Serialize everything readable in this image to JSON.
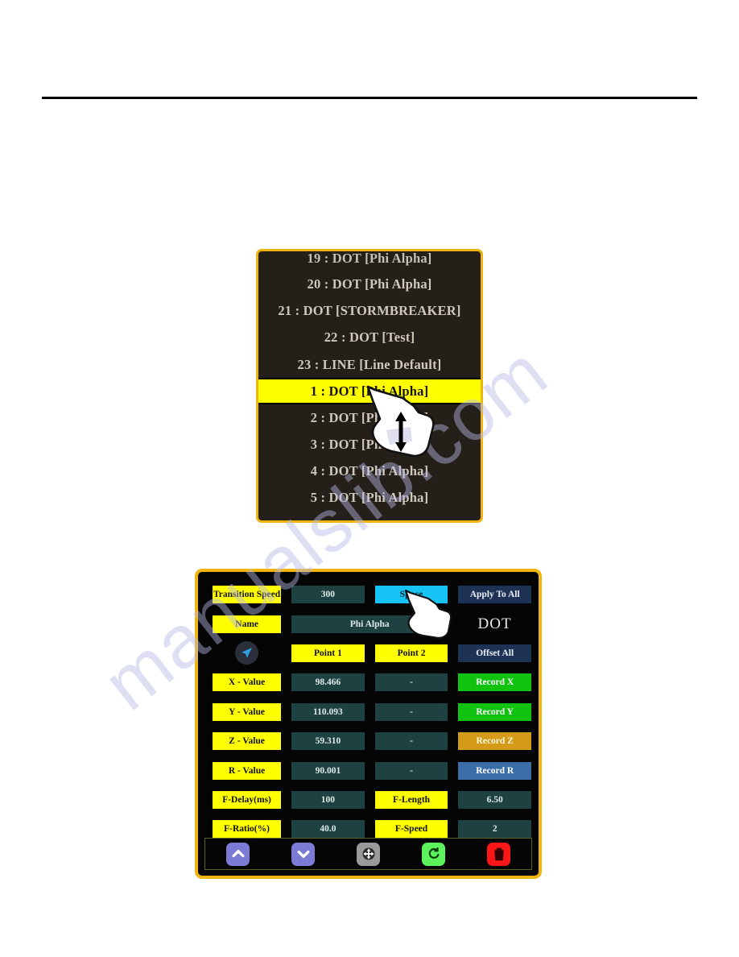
{
  "page": {
    "watermark": "manualslib.com",
    "background_color": "#ffffff",
    "rule_color": "#000000"
  },
  "list_panel": {
    "name": "point-list",
    "border_color": "#f0b410",
    "background_color": "#241f18",
    "highlight_color": "#ffff00",
    "rows": [
      {
        "label": "19 : DOT [Phi Alpha]",
        "selected": false,
        "clipped": true
      },
      {
        "label": "20 : DOT [Phi Alpha]",
        "selected": false,
        "clipped": false
      },
      {
        "label": "21 : DOT [STORMBREAKER]",
        "selected": false,
        "clipped": false
      },
      {
        "label": "22 : DOT [Test]",
        "selected": false,
        "clipped": false
      },
      {
        "label": "23 : LINE [Line Default]",
        "selected": false,
        "clipped": false
      },
      {
        "label": "1 : DOT [Phi Alpha]",
        "selected": true,
        "clipped": false
      },
      {
        "label": "2 : DOT [Phi Alpha]",
        "selected": false,
        "clipped": false
      },
      {
        "label": "3 : DOT [Phi Alpha]",
        "selected": false,
        "clipped": false
      },
      {
        "label": "4 : DOT [Phi Alpha]",
        "selected": false,
        "clipped": false
      },
      {
        "label": "5 : DOT [Phi Alpha]",
        "selected": false,
        "clipped": false
      }
    ]
  },
  "control_panel": {
    "border_color": "#f0b410",
    "background_color": "#050505",
    "rows": [
      {
        "name": "transition-speed",
        "cells": [
          {
            "text": "Transition Speed",
            "style": "yellow",
            "col": "c1",
            "interactable": true,
            "name": "transition-speed-label"
          },
          {
            "text": "300",
            "style": "teal",
            "col": "c2",
            "interactable": true,
            "name": "transition-speed-value"
          },
          {
            "text": "Space",
            "style": "cyan",
            "col": "c3",
            "interactable": true,
            "name": "space-button"
          },
          {
            "text": "Apply To All",
            "style": "navy",
            "col": "c4",
            "interactable": true,
            "name": "apply-to-all-button"
          }
        ]
      },
      {
        "name": "name-row",
        "cells": [
          {
            "text": "Name",
            "style": "yellow",
            "col": "c1",
            "interactable": true,
            "name": "name-label"
          },
          {
            "text": "Phi Alpha",
            "style": "teal",
            "col": "c23wide",
            "interactable": true,
            "name": "name-value"
          },
          {
            "text": "DOT",
            "style": "dot",
            "col": "c4",
            "interactable": false,
            "name": "type-label"
          }
        ]
      },
      {
        "name": "points-row",
        "cells": [
          {
            "text": "",
            "style": "navicon",
            "col": "c1",
            "interactable": true,
            "name": "jog-navigate-icon"
          },
          {
            "text": "Point 1",
            "style": "yellow",
            "col": "c2",
            "interactable": true,
            "name": "point-1-button"
          },
          {
            "text": "Point 2",
            "style": "yellow",
            "col": "c3",
            "interactable": true,
            "name": "point-2-button"
          },
          {
            "text": "Offset All",
            "style": "navy",
            "col": "c4",
            "interactable": true,
            "name": "offset-all-button"
          }
        ]
      },
      {
        "name": "x-value-row",
        "cells": [
          {
            "text": "X - Value",
            "style": "yellow",
            "col": "c1",
            "interactable": true,
            "name": "x-value-label"
          },
          {
            "text": "98.466",
            "style": "teal",
            "col": "c2",
            "interactable": true,
            "name": "x-value-point1"
          },
          {
            "text": "-",
            "style": "teal",
            "col": "c3",
            "interactable": true,
            "name": "x-value-point2"
          },
          {
            "text": "Record X",
            "style": "green",
            "col": "c4",
            "interactable": true,
            "name": "record-x-button"
          }
        ]
      },
      {
        "name": "y-value-row",
        "cells": [
          {
            "text": "Y - Value",
            "style": "yellow",
            "col": "c1",
            "interactable": true,
            "name": "y-value-label"
          },
          {
            "text": "110.093",
            "style": "teal",
            "col": "c2",
            "interactable": true,
            "name": "y-value-point1"
          },
          {
            "text": "-",
            "style": "teal",
            "col": "c3",
            "interactable": true,
            "name": "y-value-point2"
          },
          {
            "text": "Record Y",
            "style": "green",
            "col": "c4",
            "interactable": true,
            "name": "record-y-button"
          }
        ]
      },
      {
        "name": "z-value-row",
        "cells": [
          {
            "text": "Z - Value",
            "style": "yellow",
            "col": "c1",
            "interactable": true,
            "name": "z-value-label"
          },
          {
            "text": "59.310",
            "style": "teal",
            "col": "c2",
            "interactable": true,
            "name": "z-value-point1"
          },
          {
            "text": "-",
            "style": "teal",
            "col": "c3",
            "interactable": true,
            "name": "z-value-point2"
          },
          {
            "text": "Record Z",
            "style": "gold",
            "col": "c4",
            "interactable": true,
            "name": "record-z-button"
          }
        ]
      },
      {
        "name": "r-value-row",
        "cells": [
          {
            "text": "R - Value",
            "style": "yellow",
            "col": "c1",
            "interactable": true,
            "name": "r-value-label"
          },
          {
            "text": "90.001",
            "style": "teal",
            "col": "c2",
            "interactable": true,
            "name": "r-value-point1"
          },
          {
            "text": "-",
            "style": "teal",
            "col": "c3",
            "interactable": true,
            "name": "r-value-point2"
          },
          {
            "text": "Record R",
            "style": "blue",
            "col": "c4",
            "interactable": true,
            "name": "record-r-button"
          }
        ]
      },
      {
        "name": "f-delay-row",
        "cells": [
          {
            "text": "F-Delay(ms)",
            "style": "yellow",
            "col": "c1",
            "interactable": true,
            "name": "f-delay-label"
          },
          {
            "text": "100",
            "style": "teal",
            "col": "c2",
            "interactable": true,
            "name": "f-delay-value"
          },
          {
            "text": "F-Length",
            "style": "yellow",
            "col": "c3",
            "interactable": true,
            "name": "f-length-label"
          },
          {
            "text": "6.50",
            "style": "teal",
            "col": "c4",
            "interactable": true,
            "name": "f-length-value"
          }
        ]
      },
      {
        "name": "f-ratio-row",
        "cells": [
          {
            "text": "F-Ratio(%)",
            "style": "yellow",
            "col": "c1",
            "interactable": true,
            "name": "f-ratio-label"
          },
          {
            "text": "40.0",
            "style": "teal",
            "col": "c2",
            "interactable": true,
            "name": "f-ratio-value"
          },
          {
            "text": "F-Speed",
            "style": "yellow",
            "col": "c3",
            "interactable": true,
            "name": "f-speed-label"
          },
          {
            "text": "2",
            "style": "teal",
            "col": "c4",
            "interactable": true,
            "name": "f-speed-value"
          }
        ]
      }
    ],
    "toolbar": [
      {
        "icon": "chevron-up-icon",
        "style": "tb-purple",
        "name": "move-up-button"
      },
      {
        "icon": "chevron-down-icon",
        "style": "tb-purple",
        "name": "move-down-button"
      },
      {
        "icon": "move-arrows-icon",
        "style": "tb-gray",
        "name": "move-button"
      },
      {
        "icon": "refresh-icon",
        "style": "tb-green",
        "name": "refresh-button"
      },
      {
        "icon": "trash-icon",
        "style": "tb-red",
        "name": "delete-button"
      }
    ]
  },
  "cursors": [
    {
      "name": "scroll-hand-cursor",
      "target": "point-list"
    },
    {
      "name": "tap-hand-cursor",
      "target": "space-button"
    }
  ]
}
